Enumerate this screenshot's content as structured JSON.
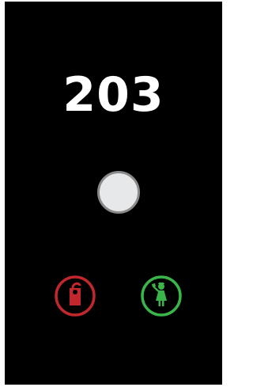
{
  "room": {
    "number": "203"
  },
  "doorbell": {
    "icon": "doorbell-button"
  },
  "status_indicators": [
    {
      "icon": "do-not-disturb-icon",
      "color": "#c1272d"
    },
    {
      "icon": "make-up-room-icon",
      "color": "#3ab54a"
    }
  ],
  "colors": {
    "panel_background": "#000000",
    "text": "#ffffff",
    "button_face": "#e6e8ea",
    "button_rim": "#8a8a8a"
  }
}
